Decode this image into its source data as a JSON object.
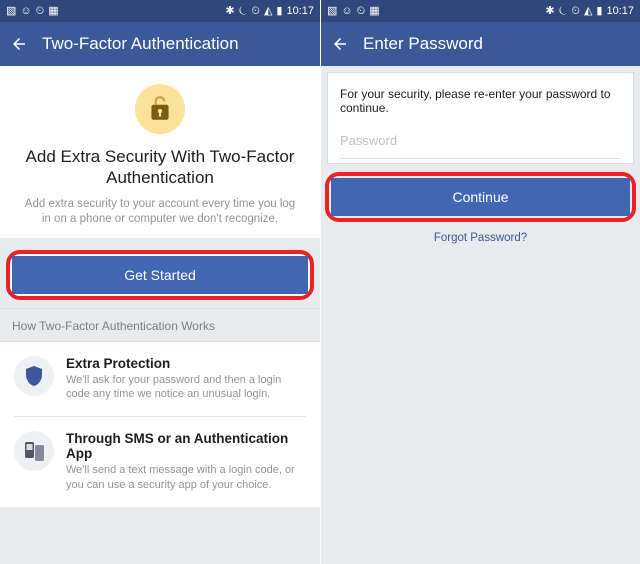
{
  "status": {
    "left_icons": [
      "▧",
      "☺",
      "⏲",
      "▦"
    ],
    "right_icons": [
      "✱",
      "⏾",
      "⏲",
      "◭",
      "▮"
    ],
    "time": "10:17"
  },
  "left": {
    "header_title": "Two-Factor Authentication",
    "main_title": "Add Extra Security With Two-Factor Authentication",
    "main_sub": "Add extra security to your account every time you log in on a phone or computer we don't recognize.",
    "get_started": "Get Started",
    "section_label": "How Two-Factor Authentication Works",
    "rows": [
      {
        "title": "Extra Protection",
        "desc": "We'll ask for your password and then a login code any time we notice an unusual login."
      },
      {
        "title": "Through SMS or an Authentication App",
        "desc": "We'll send a text message with a login code, or you can use a security app of your choice."
      }
    ]
  },
  "right": {
    "header_title": "Enter Password",
    "message": "For your security, please re-enter your password to continue.",
    "password_placeholder": "Password",
    "continue": "Continue",
    "forgot": "Forgot Password?"
  }
}
